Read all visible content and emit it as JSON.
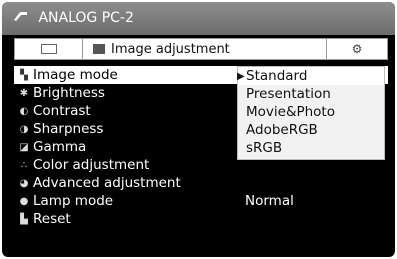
{
  "header": {
    "title": "ANALOG PC-2"
  },
  "tabs": [
    {
      "name": "tab-screen",
      "label": ""
    },
    {
      "name": "tab-image-adjustment",
      "label": "Image adjustment"
    },
    {
      "name": "tab-setup",
      "label": ""
    }
  ],
  "menu": {
    "items": [
      {
        "label": "Image mode",
        "icon": "image-mode-icon"
      },
      {
        "label": "Brightness",
        "icon": "brightness-icon"
      },
      {
        "label": "Contrast",
        "icon": "contrast-icon"
      },
      {
        "label": "Sharpness",
        "icon": "sharpness-icon"
      },
      {
        "label": "Gamma",
        "icon": "gamma-icon"
      },
      {
        "label": "Color adjustment",
        "icon": "color-adjustment-icon"
      },
      {
        "label": "Advanced adjustment",
        "icon": "advanced-adjustment-icon"
      },
      {
        "label": "Lamp mode",
        "icon": "lamp-icon",
        "value": "Normal"
      },
      {
        "label": "Reset",
        "icon": "reset-icon"
      }
    ]
  },
  "image_mode_dropdown": {
    "options": [
      "Standard",
      "Presentation",
      "Movie&Photo",
      "AdobeRGB",
      "sRGB"
    ],
    "selected": "Standard"
  },
  "colors": {
    "background": "#000000",
    "titlebar": "#7d7d7d",
    "highlight": "#ffffff",
    "text": "#ffffff"
  }
}
